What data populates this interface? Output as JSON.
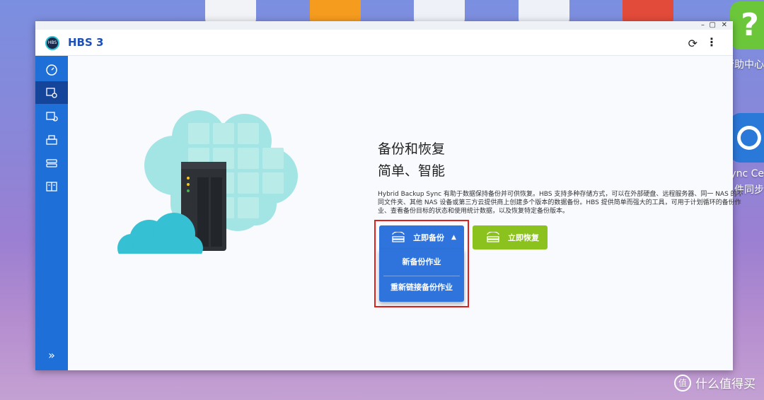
{
  "desktop": {
    "right_app_labels": [
      "帮助中心",
      "ync Ce",
      "件同步"
    ]
  },
  "window": {
    "title": "HBS 3",
    "logo_text": "HBS",
    "controls": {
      "minimize": "–",
      "maximize": "▢",
      "close": "✕"
    }
  },
  "toolbar": {
    "refresh_icon": "refresh-icon",
    "more_icon": "more-vertical-icon"
  },
  "sidebar": {
    "items": [
      {
        "icon": "dashboard-icon",
        "active": false
      },
      {
        "icon": "backup-icon",
        "active": true
      },
      {
        "icon": "sync-icon",
        "active": false
      },
      {
        "icon": "restore-icon",
        "active": false
      },
      {
        "icon": "services-icon",
        "active": false
      },
      {
        "icon": "logs-icon",
        "active": false
      }
    ],
    "expand_label": "»"
  },
  "main": {
    "headline1": "备份和恢复",
    "headline2": "简单、智能",
    "description": "Hybrid Backup Sync 有助于数据保持备份并可供恢复。HBS 支持多种存储方式，可以在外部硬盘、远程服务器、同一 NAS 的不同文件夹、其他 NAS 设备或第三方云提供商上创建多个版本的数据备份。HBS 提供简单而强大的工具，可用于计划循环的备份作业、查看备份目标的状态和使用统计数据，以及恢复特定备份版本。",
    "backup_button": "立即备份",
    "restore_button": "立即恢复",
    "dropdown": [
      "新备份作业",
      "重新链接备份作业"
    ]
  },
  "watermark": {
    "badge": "值",
    "text": "什么值得买"
  },
  "colors": {
    "accent": "#1f6fd8",
    "sidebar_active": "#14459a",
    "restore": "#8cc21e",
    "highlight": "#e0201c"
  }
}
